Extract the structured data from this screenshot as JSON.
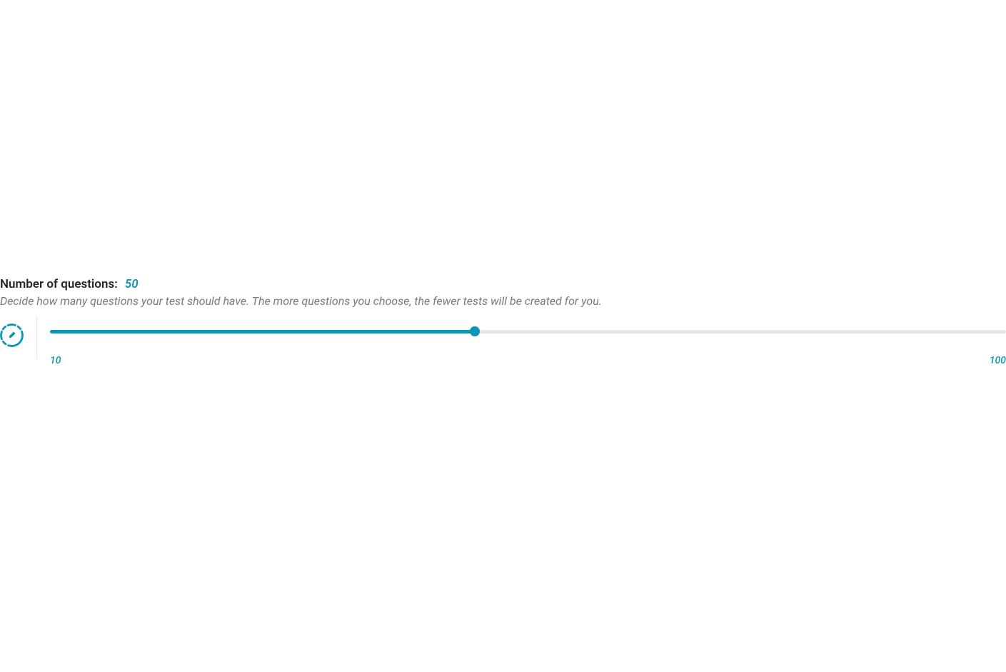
{
  "section": {
    "title_label": "Number of questions:",
    "current_value": "50",
    "description": "Decide how many questions your test should have. The more questions you choose, the fewer tests will be created for you."
  },
  "slider": {
    "min_label": "10",
    "max_label": "100",
    "min_value": 10,
    "max_value": 100,
    "current_value": 50,
    "fill_percent": "44.4%",
    "accent_color": "#0997b3"
  }
}
